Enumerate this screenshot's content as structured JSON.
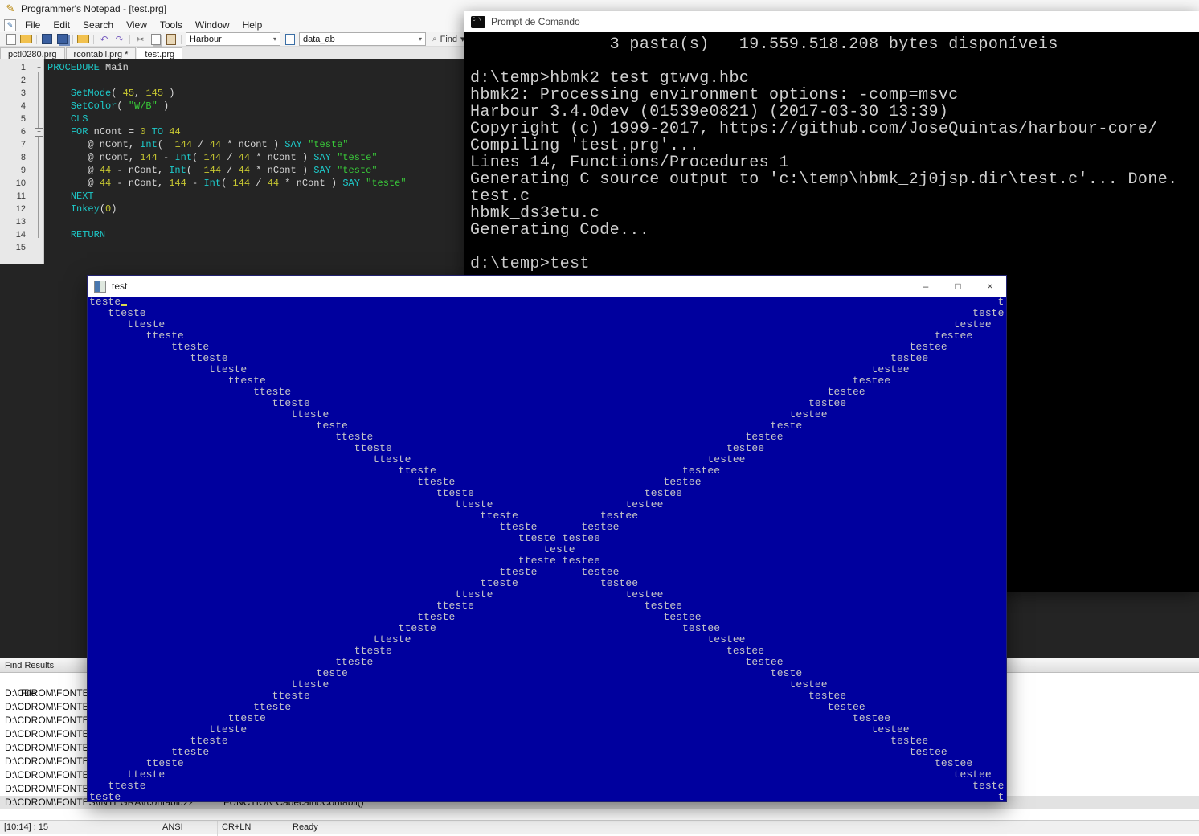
{
  "notepad": {
    "title": "Programmer's Notepad - [test.prg]",
    "menus": [
      "File",
      "Edit",
      "Search",
      "View",
      "Tools",
      "Window",
      "Help"
    ],
    "toolbar": {
      "scheme": "Harbour",
      "search_text": "data_ab",
      "find_label": "Find"
    },
    "tabs": [
      {
        "label": "pctl0280.prg",
        "active": false
      },
      {
        "label": "rcontabil.prg *",
        "active": false
      },
      {
        "label": "test.prg",
        "active": true
      }
    ],
    "editor": {
      "line_count": 15,
      "lines": [
        [
          [
            "k",
            "PROCEDURE"
          ],
          [
            "p",
            " Main"
          ]
        ],
        [],
        [
          [
            "p",
            "    "
          ],
          [
            "k",
            "SetMode"
          ],
          [
            "p",
            "( "
          ],
          [
            "n",
            "45"
          ],
          [
            "p",
            ", "
          ],
          [
            "n",
            "145"
          ],
          [
            "p",
            " )"
          ]
        ],
        [
          [
            "p",
            "    "
          ],
          [
            "k",
            "SetColor"
          ],
          [
            "p",
            "( "
          ],
          [
            "s",
            "\"W/B\""
          ],
          [
            "p",
            " )"
          ]
        ],
        [
          [
            "p",
            "    "
          ],
          [
            "k",
            "CLS"
          ]
        ],
        [
          [
            "p",
            "    "
          ],
          [
            "k",
            "FOR"
          ],
          [
            "p",
            " nCont = "
          ],
          [
            "n",
            "0"
          ],
          [
            "p",
            " "
          ],
          [
            "k",
            "TO"
          ],
          [
            "p",
            " "
          ],
          [
            "n",
            "44"
          ]
        ],
        [
          [
            "p",
            "       @ nCont, "
          ],
          [
            "k",
            "Int"
          ],
          [
            "p",
            "(  "
          ],
          [
            "n",
            "144"
          ],
          [
            "p",
            " / "
          ],
          [
            "n",
            "44"
          ],
          [
            "p",
            " * nCont ) "
          ],
          [
            "k",
            "SAY"
          ],
          [
            "p",
            " "
          ],
          [
            "s",
            "\"teste\""
          ]
        ],
        [
          [
            "p",
            "       @ nCont, "
          ],
          [
            "n",
            "144"
          ],
          [
            "p",
            " - "
          ],
          [
            "k",
            "Int"
          ],
          [
            "p",
            "( "
          ],
          [
            "n",
            "144"
          ],
          [
            "p",
            " / "
          ],
          [
            "n",
            "44"
          ],
          [
            "p",
            " * nCont ) "
          ],
          [
            "k",
            "SAY"
          ],
          [
            "p",
            " "
          ],
          [
            "s",
            "\"teste\""
          ]
        ],
        [
          [
            "p",
            "       @ "
          ],
          [
            "n",
            "44"
          ],
          [
            "p",
            " - nCont, "
          ],
          [
            "k",
            "Int"
          ],
          [
            "p",
            "(  "
          ],
          [
            "n",
            "144"
          ],
          [
            "p",
            " / "
          ],
          [
            "n",
            "44"
          ],
          [
            "p",
            " * nCont ) "
          ],
          [
            "k",
            "SAY"
          ],
          [
            "p",
            " "
          ],
          [
            "s",
            "\"teste\""
          ]
        ],
        [
          [
            "p",
            "       @ "
          ],
          [
            "n",
            "44"
          ],
          [
            "p",
            " - nCont, "
          ],
          [
            "n",
            "144"
          ],
          [
            "p",
            " - "
          ],
          [
            "k",
            "Int"
          ],
          [
            "p",
            "( "
          ],
          [
            "n",
            "144"
          ],
          [
            "p",
            " / "
          ],
          [
            "n",
            "44"
          ],
          [
            "p",
            " * nCont ) "
          ],
          [
            "k",
            "SAY"
          ],
          [
            "p",
            " "
          ],
          [
            "s",
            "\"teste\""
          ]
        ],
        [
          [
            "p",
            "    "
          ],
          [
            "k",
            "NEXT"
          ]
        ],
        [
          [
            "p",
            "    "
          ],
          [
            "k",
            "Inkey"
          ],
          [
            "p",
            "("
          ],
          [
            "n",
            "0"
          ],
          [
            "p",
            ")"
          ]
        ],
        [],
        [
          [
            "p",
            "    "
          ],
          [
            "k",
            "RETURN"
          ]
        ],
        []
      ]
    },
    "find_results": {
      "header": "Find Results",
      "file_column": "File",
      "truncated_rows": [
        "D:\\CDROM\\FONTES\\IN",
        "D:\\CDROM\\FONTES\\IN",
        "D:\\CDROM\\FONTES\\IN",
        "D:\\CDROM\\FONTES\\IN",
        "D:\\CDROM\\FONTES\\IN",
        "D:\\CDROM\\FONTES\\IN",
        "D:\\CDROM\\FONTES\\IN",
        "D:\\CDROM\\FONTES\\IN"
      ],
      "selected": {
        "file": "D:\\CDROM\\FONTES\\INTEGRA\\rcontabil.prg",
        "line": "22",
        "text": "FUNCTION CabecalhoContabil()"
      }
    },
    "status_bar": {
      "position": "[10:14] : 15",
      "encoding": "ANSI",
      "line_ending": "CR+LN",
      "state": "Ready"
    }
  },
  "cmd": {
    "title": "Prompt de Comando",
    "lines": [
      "              3 pasta(s)   19.559.518.208 bytes disponíveis",
      "",
      "d:\\temp>hbmk2 test gtwvg.hbc",
      "hbmk2: Processing environment options: -comp=msvc",
      "Harbour 3.4.0dev (01539e0821) (2017-03-30 13:39)",
      "Copyright (c) 1999-2017, https://github.com/JoseQuintas/harbour-core/",
      "Compiling 'test.prg'...",
      "Lines 14, Functions/Procedures 1",
      "Generating C source output to 'c:\\temp\\hbmk_2j0jsp.dir\\test.c'... Done.",
      "test.c",
      "hbmk_ds3etu.c",
      "Generating Code...",
      "",
      "d:\\temp>test"
    ]
  },
  "test_window": {
    "title": "test",
    "console": {
      "rows": 45,
      "cols": 145,
      "cursor": {
        "row": 0,
        "col": 5
      },
      "row_data": [
        [
          0,
          "teste",
          144,
          "t"
        ],
        [
          3,
          "tteste",
          140,
          "teste"
        ],
        [
          6,
          "tteste",
          137,
          "testee"
        ],
        [
          9,
          "tteste",
          134,
          "testee"
        ],
        [
          13,
          "tteste",
          130,
          "testee"
        ],
        [
          16,
          "tteste",
          127,
          "testee"
        ],
        [
          19,
          "tteste",
          124,
          "testee"
        ],
        [
          22,
          "tteste",
          121,
          "testee"
        ],
        [
          26,
          "tteste",
          117,
          "testee"
        ],
        [
          29,
          "tteste",
          114,
          "testee"
        ],
        [
          32,
          "tteste",
          111,
          "testee"
        ],
        [
          36,
          "teste",
          108,
          "teste"
        ],
        [
          39,
          "tteste",
          104,
          "testee"
        ],
        [
          42,
          "tteste",
          101,
          "testee"
        ],
        [
          45,
          "tteste",
          98,
          "testee"
        ],
        [
          49,
          "tteste",
          94,
          "testee"
        ],
        [
          52,
          "tteste",
          91,
          "testee"
        ],
        [
          55,
          "tteste",
          88,
          "testee"
        ],
        [
          58,
          "tteste",
          85,
          "testee"
        ],
        [
          62,
          "tteste",
          81,
          "testee"
        ],
        [
          65,
          "tteste",
          78,
          "testee"
        ],
        [
          68,
          "tteste",
          75,
          "testee"
        ],
        [
          72,
          "teste",
          null,
          null
        ],
        [
          68,
          "tteste",
          75,
          "testee"
        ],
        [
          65,
          "tteste",
          78,
          "testee"
        ],
        [
          62,
          "tteste",
          81,
          "testee"
        ],
        [
          58,
          "tteste",
          85,
          "testee"
        ],
        [
          55,
          "tteste",
          88,
          "testee"
        ],
        [
          52,
          "tteste",
          91,
          "testee"
        ],
        [
          49,
          "tteste",
          94,
          "testee"
        ],
        [
          45,
          "tteste",
          98,
          "testee"
        ],
        [
          42,
          "tteste",
          101,
          "testee"
        ],
        [
          39,
          "tteste",
          104,
          "testee"
        ],
        [
          36,
          "teste",
          108,
          "teste"
        ],
        [
          32,
          "tteste",
          111,
          "testee"
        ],
        [
          29,
          "tteste",
          114,
          "testee"
        ],
        [
          26,
          "tteste",
          117,
          "testee"
        ],
        [
          22,
          "tteste",
          121,
          "testee"
        ],
        [
          19,
          "tteste",
          124,
          "testee"
        ],
        [
          16,
          "tteste",
          127,
          "testee"
        ],
        [
          13,
          "tteste",
          130,
          "testee"
        ],
        [
          9,
          "tteste",
          134,
          "testee"
        ],
        [
          6,
          "tteste",
          137,
          "testee"
        ],
        [
          3,
          "tteste",
          140,
          "teste"
        ],
        [
          0,
          "teste",
          144,
          "t"
        ]
      ]
    }
  },
  "icons": {
    "minimize": "–",
    "maximize": "□",
    "close": "×",
    "chevron_down": "▾",
    "undo": "↶",
    "redo": "↷",
    "cut": "✂",
    "find_caret": "▾",
    "cmd_badge": "C:\\",
    "pencil": "✎"
  },
  "colors": {
    "console_bg": "#00009e",
    "console_fg": "#c6c6c6",
    "console_cursor": "#d9d94e",
    "editor_bg": "#242424",
    "keyword": "#1ec8c8",
    "number": "#c8c832",
    "string": "#39c839",
    "plain": "#d8d8d8",
    "cmd_bg": "#000000",
    "cmd_fg": "#cfcfcf"
  }
}
